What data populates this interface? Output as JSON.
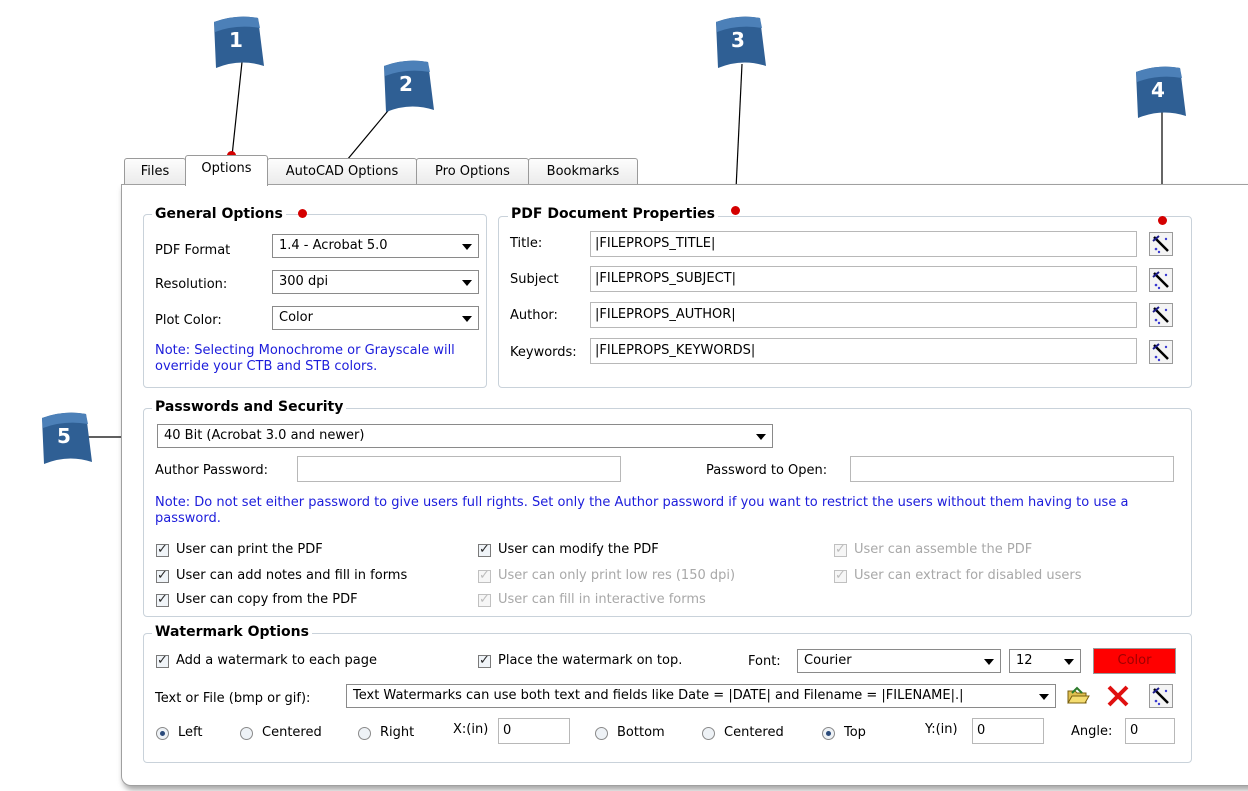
{
  "callouts": [
    "1",
    "2",
    "3",
    "4",
    "5"
  ],
  "tabs": [
    "Files",
    "Options",
    "AutoCAD Options",
    "Pro Options",
    "Bookmarks"
  ],
  "general": {
    "title": "General Options",
    "pdf_format_label": "PDF Format",
    "pdf_format_value": "1.4 - Acrobat 5.0",
    "resolution_label": "Resolution:",
    "resolution_value": "300 dpi",
    "plot_color_label": "Plot Color:",
    "plot_color_value": "Color",
    "note": "Note:  Selecting Monochrome or Grayscale will override your CTB and STB colors."
  },
  "docprops": {
    "title": "PDF Document Properties",
    "fields": [
      {
        "label": "Title:",
        "value": "|FILEPROPS_TITLE|"
      },
      {
        "label": "Subject",
        "value": "|FILEPROPS_SUBJECT|"
      },
      {
        "label": "Author:",
        "value": "|FILEPROPS_AUTHOR|"
      },
      {
        "label": "Keywords:",
        "value": "|FILEPROPS_KEYWORDS|"
      }
    ]
  },
  "security": {
    "title": "Passwords and Security",
    "encryption_value": "40 Bit (Acrobat 3.0 and newer)",
    "author_password_label": "Author Password:",
    "author_password_value": "",
    "open_password_label": "Password to Open:",
    "open_password_value": "",
    "note": "Note:  Do not set either password to give users full rights.  Set only the Author password if you want to restrict the users without them having to use a password.",
    "permissions": [
      {
        "label": "User can print the PDF",
        "checked": true,
        "enabled": true
      },
      {
        "label": "User can add notes and fill in forms",
        "checked": true,
        "enabled": true
      },
      {
        "label": "User can copy from the PDF",
        "checked": true,
        "enabled": true
      },
      {
        "label": "User can modify the PDF",
        "checked": true,
        "enabled": true
      },
      {
        "label": "User can only print low res (150 dpi)",
        "checked": true,
        "enabled": false
      },
      {
        "label": "User can fill in interactive forms",
        "checked": true,
        "enabled": false
      },
      {
        "label": "User can assemble the PDF",
        "checked": true,
        "enabled": false
      },
      {
        "label": "User can extract for disabled users",
        "checked": true,
        "enabled": false
      }
    ]
  },
  "watermark": {
    "title": "Watermark Options",
    "add_label": "Add a watermark to each page",
    "on_top_label": "Place the watermark on top.",
    "font_label": "Font:",
    "font_value": "Courier",
    "size_value": "12",
    "color_label": "Color",
    "color_hex": "#ff0000",
    "text_label": "Text or File (bmp or gif):",
    "text_value": "Text Watermarks can use both text and fields like Date = |DATE| and Filename = |FILENAME|.|",
    "h_align": [
      "Left",
      "Centered",
      "Right"
    ],
    "h_selected": "Left",
    "x_label": "X:(in)",
    "x_value": "0",
    "v_align": [
      "Bottom",
      "Centered",
      "Top"
    ],
    "v_selected": "Top",
    "y_label": "Y:(in)",
    "y_value": "0",
    "angle_label": "Angle:",
    "angle_value": "0"
  },
  "icons": [
    "flag-callout-icon",
    "field-picker-icon",
    "folder-open-icon",
    "delete-x-icon"
  ],
  "colors": {
    "callout": "#2f5f94",
    "note": "#1c1cdb",
    "marker": "#d40000"
  }
}
